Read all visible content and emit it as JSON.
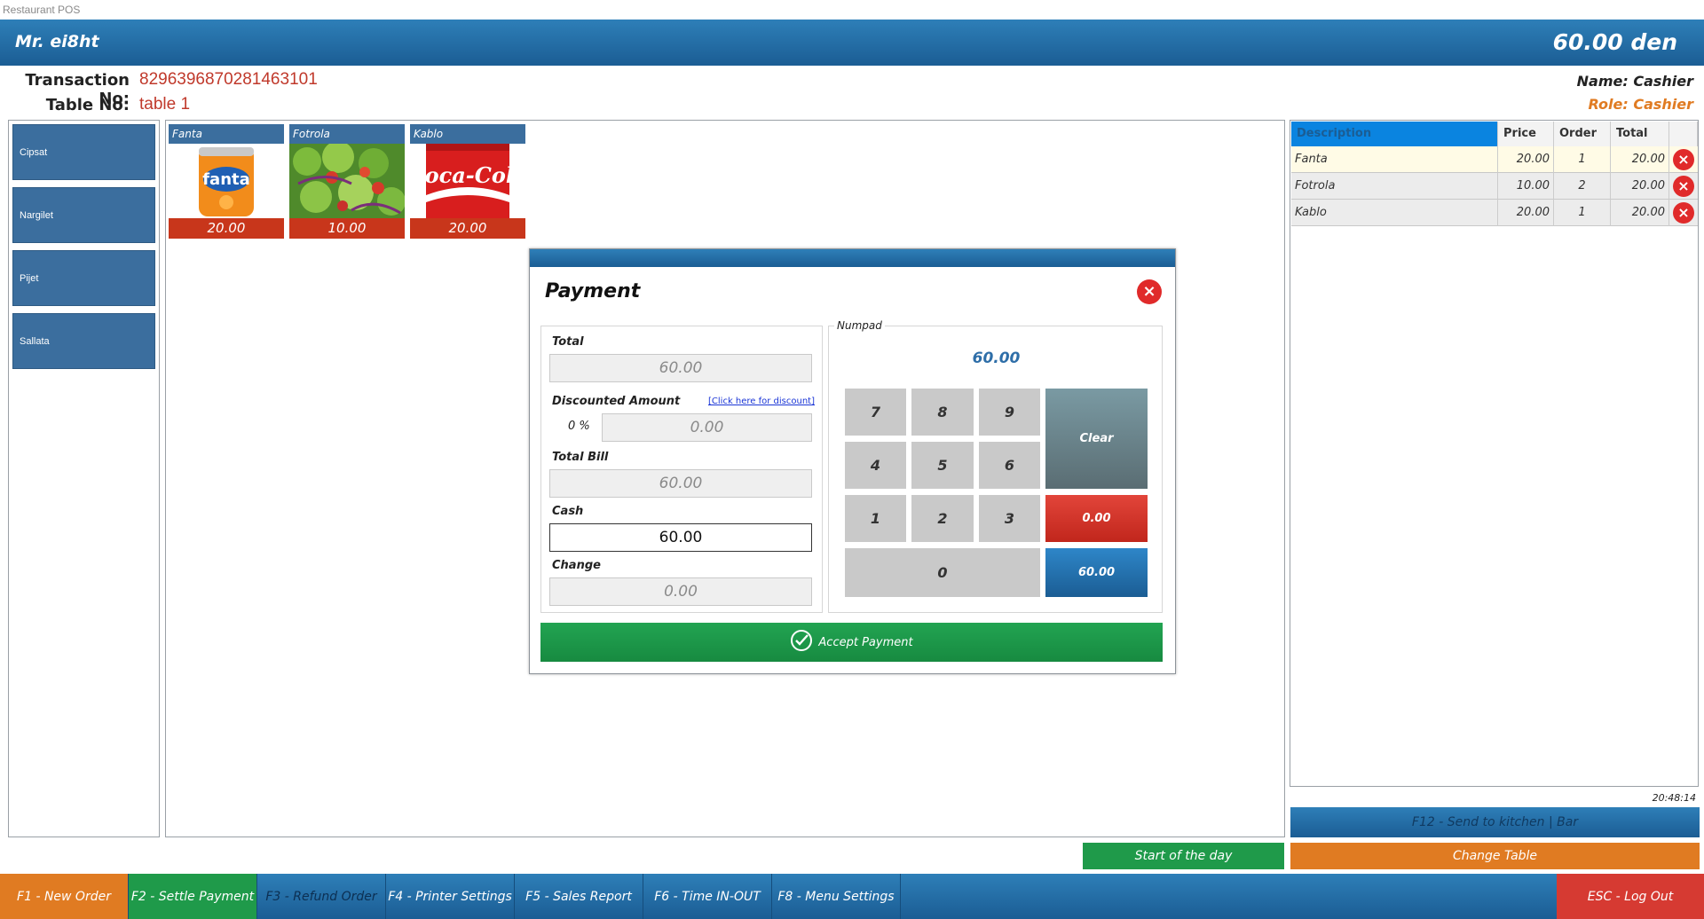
{
  "window": {
    "title": "Restaurant POS"
  },
  "header": {
    "user": "Mr. ei8ht",
    "amount": "60.00 den"
  },
  "transaction": {
    "no_label": "Transaction No:",
    "no_value": "8296396870281463101",
    "table_label": "Table No:",
    "table_value": "table 1"
  },
  "staff": {
    "name": "Name: Cashier",
    "role": "Role: Cashier"
  },
  "categories": [
    "Cipsat",
    "Nargilet",
    "Pijet",
    "Sallata"
  ],
  "products": [
    {
      "name": "Fanta",
      "price": "20.00",
      "image": "fanta-can"
    },
    {
      "name": "Fotrola",
      "price": "10.00",
      "image": "salad"
    },
    {
      "name": "Kablo",
      "price": "20.00",
      "image": "coca-cola-can"
    }
  ],
  "order_table": {
    "headers": [
      "Description",
      "Price",
      "Order",
      "Total"
    ],
    "rows": [
      {
        "description": "Fanta",
        "price": "20.00",
        "order": "1",
        "total": "20.00"
      },
      {
        "description": "Fotrola",
        "price": "10.00",
        "order": "2",
        "total": "20.00"
      },
      {
        "description": "Kablo",
        "price": "20.00",
        "order": "1",
        "total": "20.00"
      }
    ],
    "time": "20:48:14"
  },
  "actions": {
    "send_kitchen": "F12 - Send to kitchen | Bar",
    "start_day": "Start of the day",
    "change_table": "Change Table"
  },
  "function_bar": [
    {
      "label": "F1 - New Order",
      "color": "#e07b22"
    },
    {
      "label": "F2 - Settle Payment",
      "color": "#1f9a4a"
    },
    {
      "label": "F3 - Refund Order",
      "color": "#1b5d94"
    },
    {
      "label": "F4 - Printer Settings",
      "color": "#1b5d94"
    },
    {
      "label": "F5 - Sales Report",
      "color": "#1b5d94"
    },
    {
      "label": "F6 - Time IN-OUT",
      "color": "#1b5d94"
    },
    {
      "label": "F8 - Menu Settings",
      "color": "#1b5d94"
    },
    {
      "label": "ESC - Log Out",
      "color": "#d63a32"
    }
  ],
  "payment": {
    "title": "Payment",
    "total_label": "Total",
    "total_value": "60.00",
    "discount_label": "Discounted Amount",
    "discount_link": "[Click here for discount]",
    "discount_percent": "0 %",
    "discount_value": "0.00",
    "total_bill_label": "Total Bill",
    "total_bill_value": "60.00",
    "cash_label": "Cash",
    "cash_value": "60.00",
    "change_label": "Change",
    "change_value": "0.00",
    "numpad_label": "Numpad",
    "numpad_display": "60.00",
    "keys": [
      "7",
      "8",
      "9",
      "4",
      "5",
      "6",
      "1",
      "2",
      "3",
      "0"
    ],
    "clear_label": "Clear",
    "quick_zero": "0.00",
    "quick_exact": "60.00",
    "accept_label": "Accept Payment"
  },
  "colors": {
    "header_blue": "#1b5d94",
    "category_blue": "#3b6e9e",
    "price_red": "#c8361b",
    "green": "#1f9a4a",
    "orange": "#e07b22",
    "accent_text": "#c0392b"
  }
}
